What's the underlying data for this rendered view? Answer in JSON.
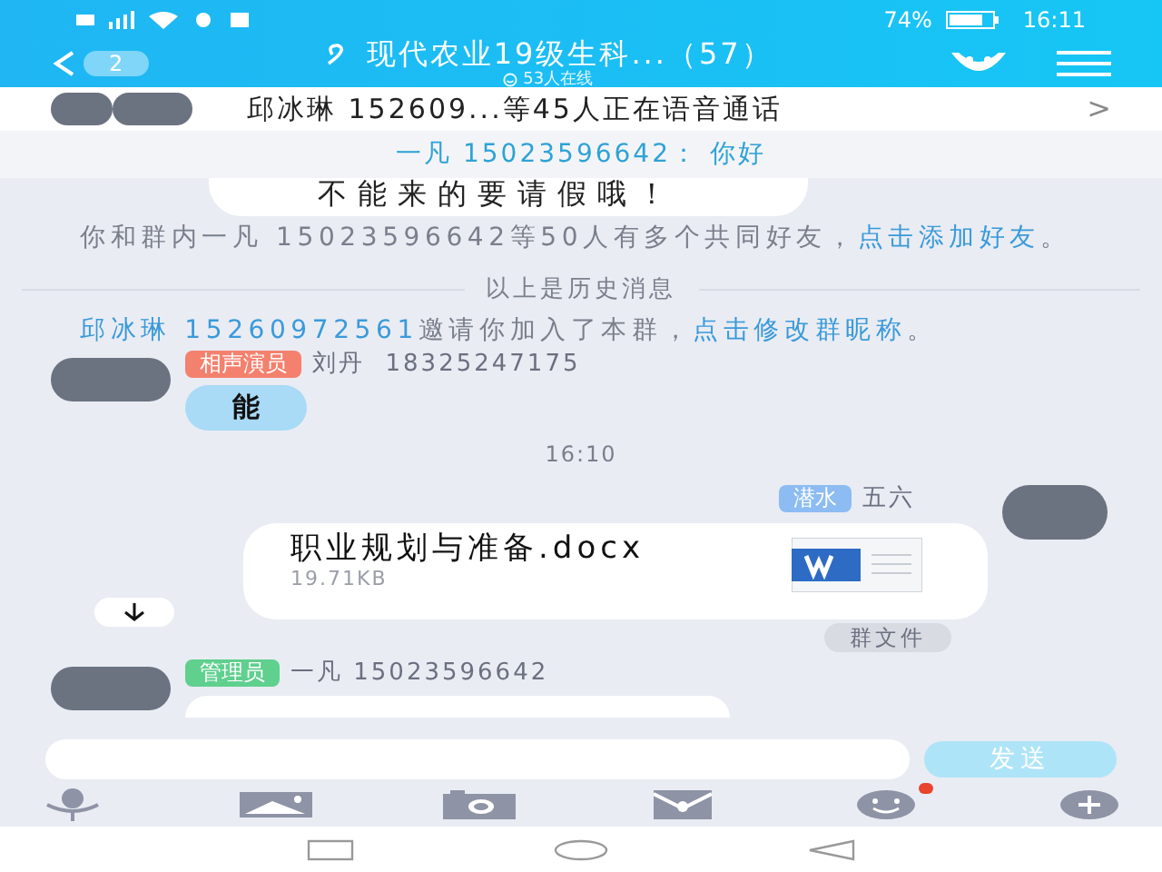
{
  "status_bar": {
    "battery": "74%",
    "time": "16:11"
  },
  "header": {
    "back_badge": "2",
    "title": "现代农业19级生科...（57）",
    "subtitle": "53人在线"
  },
  "voice_call": {
    "text": "邱冰琳 152609...等45人正在语音通话",
    "arrow": ">"
  },
  "pinned": {
    "text": "一凡 15023596642： 你好"
  },
  "messages": [
    {
      "kind": "bubble",
      "text": "不能来的要请假哦！"
    },
    {
      "kind": "notice",
      "parts": [
        {
          "text": "你和群内一凡 15023596642等50人有多个共同好友，",
          "link": false
        },
        {
          "text": "点击添加好友",
          "link": true
        },
        {
          "text": "。",
          "link": false
        }
      ]
    },
    {
      "kind": "divider",
      "text": "以上是历史消息"
    },
    {
      "kind": "notice",
      "parts": [
        {
          "text": "邱冰琳 15260972561",
          "link": true
        },
        {
          "text": "邀请你加入了本群，",
          "link": false
        },
        {
          "text": "点击修改群昵称",
          "link": true
        },
        {
          "text": "。",
          "link": false
        }
      ]
    },
    {
      "kind": "bubble",
      "badge": {
        "text": "相声演员",
        "color": "#f4806e"
      },
      "sender": "刘丹  18325247175",
      "text": "能"
    },
    {
      "kind": "time",
      "text": "16:10"
    },
    {
      "kind": "file",
      "badge": {
        "text": "潜水",
        "color": "#8cbcf2"
      },
      "sender": "五六",
      "file_name": "职业规划与准备.docx",
      "size": "19.71KB",
      "tag": "群文件"
    },
    {
      "kind": "bubble",
      "badge": {
        "text": "管理员",
        "color": "#5fd08e"
      },
      "sender": "一凡 15023596642"
    }
  ],
  "input": {
    "send": "发送"
  },
  "toolbar": [
    {
      "kind": "mic",
      "dot": false
    },
    {
      "kind": "image",
      "dot": false
    },
    {
      "kind": "camera",
      "dot": false
    },
    {
      "kind": "envelope",
      "dot": false
    },
    {
      "kind": "emoji",
      "dot": true
    },
    {
      "kind": "plus",
      "dot": false
    }
  ]
}
